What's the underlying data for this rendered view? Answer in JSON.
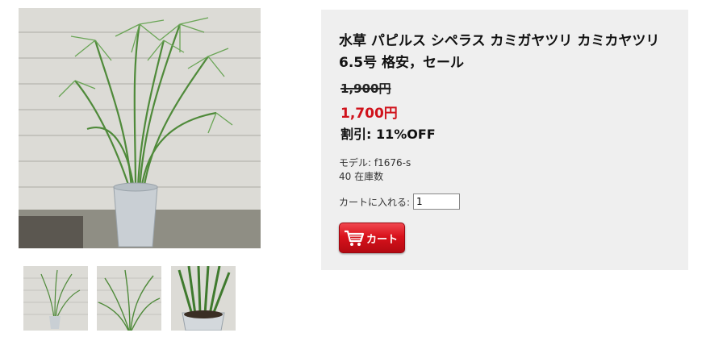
{
  "product": {
    "title": "水草 パピルス シペラス カミガヤツリ カミカヤツリ 6.5号 格安，セール",
    "old_price": "1,900円",
    "new_price": "1,700円",
    "discount": "割引: 11%OFF",
    "model": "モデル: f1676-s",
    "stock": "40 在庫数"
  },
  "cart": {
    "qty_label": "カートに入れる:",
    "qty_value": "1",
    "button_label": "カート"
  },
  "colors": {
    "panel_bg": "#efefef",
    "sale_red": "#d0121b",
    "button_red": "#d9121c"
  }
}
